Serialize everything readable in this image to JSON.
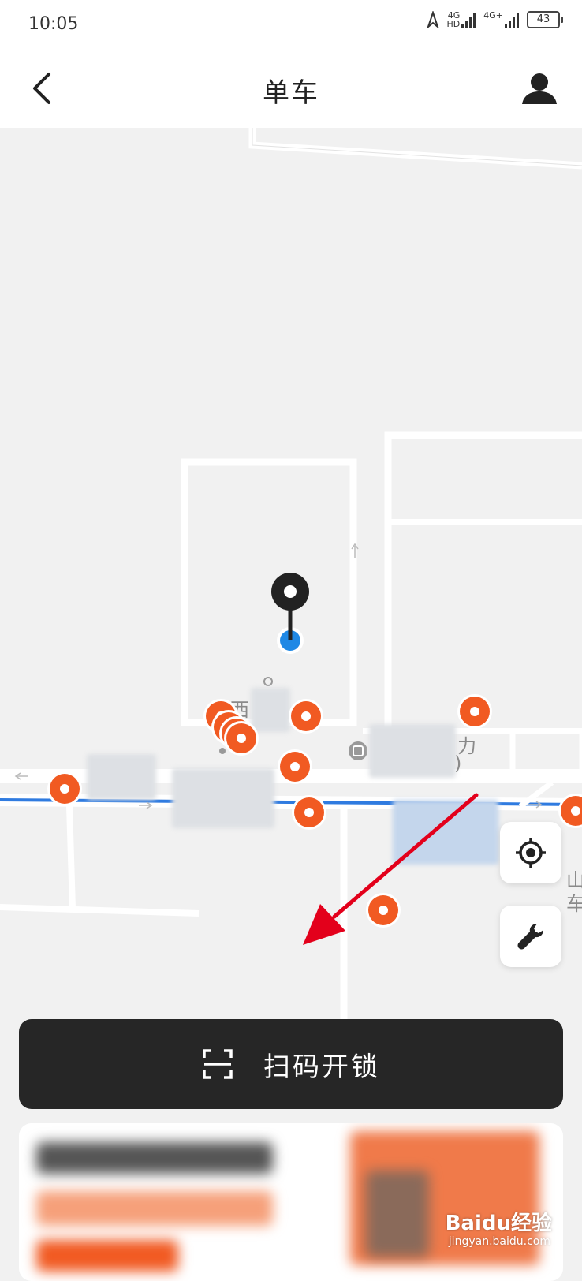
{
  "status_bar": {
    "time": "10:05",
    "network_1": "4G",
    "network_1_sub": "HD",
    "network_2": "4G+",
    "battery": "43"
  },
  "header": {
    "title": "单车"
  },
  "map": {
    "labels": [
      "西",
      "力",
      ")",
      "车",
      "山"
    ],
    "colors": {
      "bike_marker": "#f15a22",
      "route_line": "#2f7be0",
      "user_dot": "#1e88e5",
      "pin": "#222222",
      "road": "#ffffff",
      "annotation_arrow": "#e3001b"
    }
  },
  "controls": {
    "locate_icon": "crosshair-icon",
    "repair_icon": "wrench-icon"
  },
  "scan_button": {
    "label": "扫码开锁",
    "icon": "scan-icon"
  },
  "watermark": {
    "text": "Baidu经验",
    "sub": "jingyan.baidu.com"
  }
}
